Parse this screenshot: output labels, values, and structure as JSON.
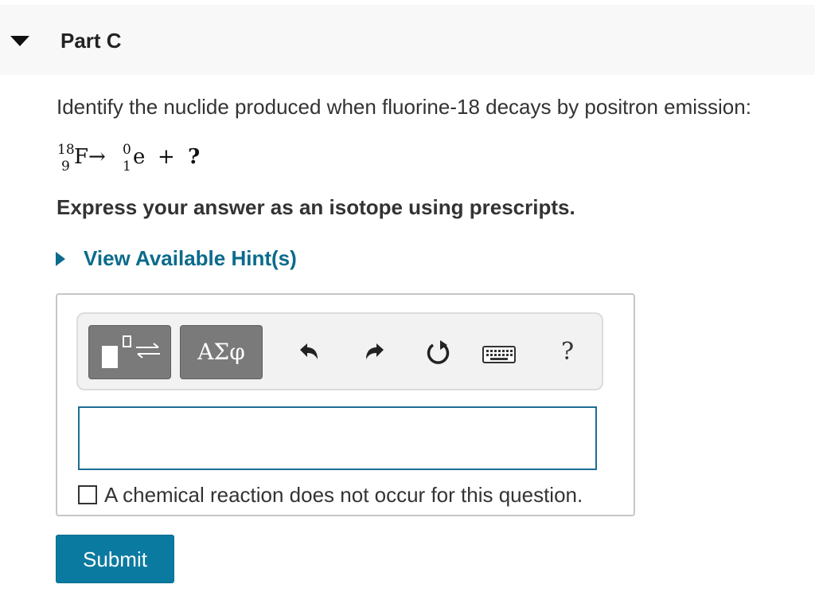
{
  "colors": {
    "header_bg": "#f8f8f8",
    "link": "#0b6b8c",
    "submit_bg": "#0b7aa0",
    "input_border": "#1d6d94",
    "toolbar_button": "#7a7a7a"
  },
  "part": {
    "toggle_icon": "collapse-arrow-icon",
    "title": "Part C"
  },
  "question": {
    "text": "Identify the nuclide produced when fluorine-18 decays by positron emission:",
    "equation": {
      "reactant_mass": "18",
      "reactant_atomic": "9",
      "reactant_symbol": "F",
      "arrow": "→",
      "product_mass": "0",
      "product_atomic": "1",
      "product_symbol": "e",
      "plus": "+",
      "unknown": "?"
    },
    "instruction": "Express your answer as an isotope using prescripts."
  },
  "hints": {
    "icon": "expand-arrow-icon",
    "label": "View Available Hint(s)"
  },
  "toolbar": {
    "templates_icon": "templates-icon",
    "symbols_label": "ΑΣφ",
    "undo_icon": "undo-icon",
    "redo_icon": "redo-icon",
    "reset_icon": "reset-icon",
    "keyboard_icon": "keyboard-icon",
    "help_label": "?"
  },
  "answer": {
    "value": ""
  },
  "no_reaction": {
    "checked": false,
    "label": "A chemical reaction does not occur for this question."
  },
  "submit_label": "Submit"
}
